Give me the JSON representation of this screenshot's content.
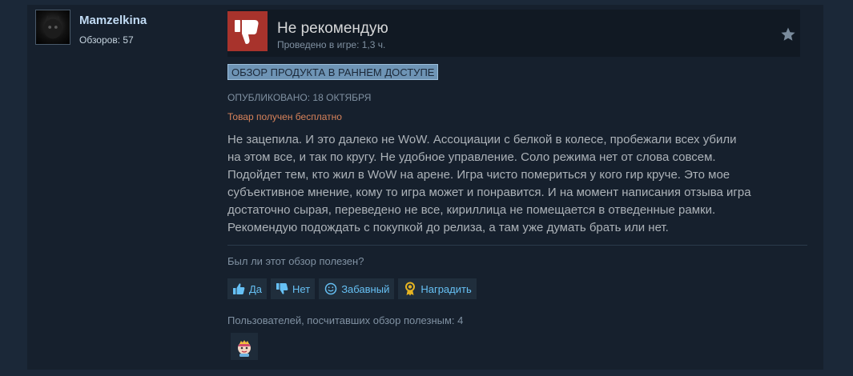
{
  "author": {
    "name": "Mamzelkina",
    "reviews_label": "Обзоров: 57"
  },
  "review": {
    "verdict": "Не рекомендую",
    "playtime": "Проведено в игре: 1,3 ч.",
    "early_access_badge": "ОБЗОР ПРОДУКТА В РАННЕМ ДОСТУПЕ",
    "posted": "ОПУБЛИКОВАНО: 18 ОКТЯБРЯ",
    "received_free": "Товар получен бесплатно",
    "body_lines": [
      "Не зацепила. И это далеко не WoW. Ассоциации с белкой в колесе, пробежали всех убили",
      "на этом все, и так по кругу. Не удобное управление. Соло режима нет от слова совсем.",
      "Подойдет тем, кто жил в WoW на арене. Игра чисто помериться у кого гир круче. Это мое",
      "субъективное мнение, кому то игра может и понравится. И на момент написания отзыва игра",
      "достаточно сырая, переведено не все, кириллица не помещается в отведенные рамки.",
      "Рекомендую подождать с покупкой до релиза, а там уже думать брать или нет."
    ]
  },
  "feedback": {
    "question": "Был ли этот обзор полезен?",
    "yes": "Да",
    "no": "Нет",
    "funny": "Забавный",
    "award": "Наградить",
    "helpful_count": "Пользователей, посчитавших обзор полезным: 4"
  },
  "colors": {
    "background": "#1b2838",
    "accent": "#66c0f4",
    "not_recommended": "#a8332c",
    "free_notice": "#d7825a"
  },
  "icons": {
    "verdict": "thumbs-down-icon",
    "star": "star-icon",
    "yes": "thumbs-up-icon",
    "no": "thumbs-down-icon",
    "funny": "smiley-icon",
    "award": "award-ribbon-icon",
    "received_award": "award-character-icon"
  }
}
